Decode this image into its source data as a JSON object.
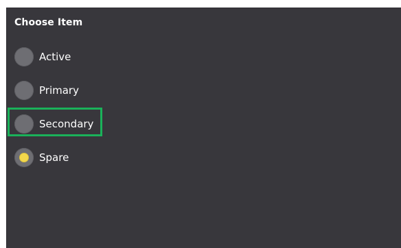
{
  "title": "Choose Item",
  "options": [
    {
      "label": "Active",
      "selected": false
    },
    {
      "label": "Primary",
      "selected": false
    },
    {
      "label": "Secondary",
      "selected": false,
      "highlighted": true
    },
    {
      "label": "Spare",
      "selected": true
    }
  ],
  "colors": {
    "panel_bg": "#38373c",
    "radio_bg": "#6e6e73",
    "selected_dot": "#f4d84c",
    "highlight_border": "#1ab25a",
    "text": "#ffffff"
  }
}
